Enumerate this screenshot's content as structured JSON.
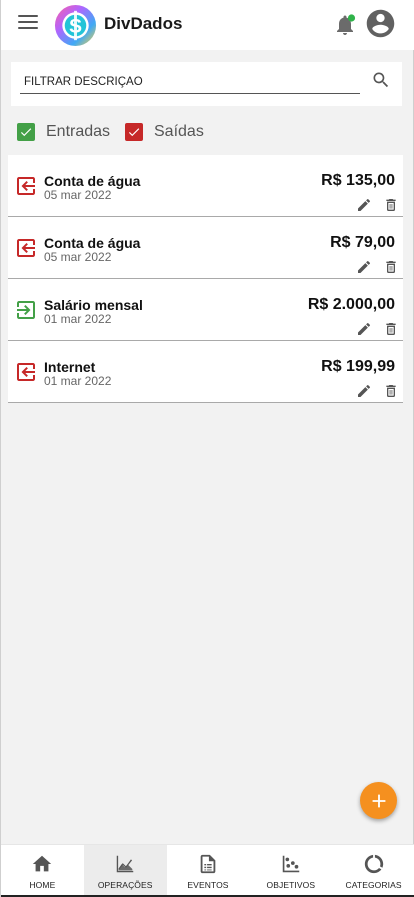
{
  "header": {
    "title": "DivDados",
    "menu_icon": "hamburger-menu-icon",
    "notification_icon": "bell-icon",
    "notification_dot_color": "#2fb34a",
    "avatar_icon": "account-circle-icon"
  },
  "filter": {
    "placeholder": "FILTRAR DESCRIÇÃO",
    "value": ""
  },
  "checkboxes": {
    "entradas": {
      "label": "Entradas",
      "checked": true,
      "color": "#43a047"
    },
    "saidas": {
      "label": "Saídas",
      "checked": true,
      "color": "#c62828"
    }
  },
  "transactions": [
    {
      "type": "saida",
      "description": "Conta de água",
      "date": "05 mar 2022",
      "amount": "R$ 135,00"
    },
    {
      "type": "saida",
      "description": "Conta de água",
      "date": "05 mar 2022",
      "amount": "R$ 79,00"
    },
    {
      "type": "entrada",
      "description": "Salário mensal",
      "date": "01 mar 2022",
      "amount": "R$ 2.000,00"
    },
    {
      "type": "saida",
      "description": "Internet",
      "date": "01 mar 2022",
      "amount": "R$ 199,99"
    }
  ],
  "fab": {
    "icon": "plus-icon",
    "color": "#f5901f"
  },
  "bottom_nav": [
    {
      "label": "HOME",
      "icon": "home-icon",
      "active": false
    },
    {
      "label": "OPERAÇÕES",
      "icon": "chart-line-icon",
      "active": true
    },
    {
      "label": "EVENTOS",
      "icon": "document-icon",
      "active": false
    },
    {
      "label": "OBJETIVOS",
      "icon": "scatter-chart-icon",
      "active": false
    },
    {
      "label": "CATEGORIAS",
      "icon": "donut-chart-icon",
      "active": false
    }
  ],
  "colors": {
    "income": "#43a047",
    "expense": "#c62828",
    "accent": "#f5901f"
  }
}
